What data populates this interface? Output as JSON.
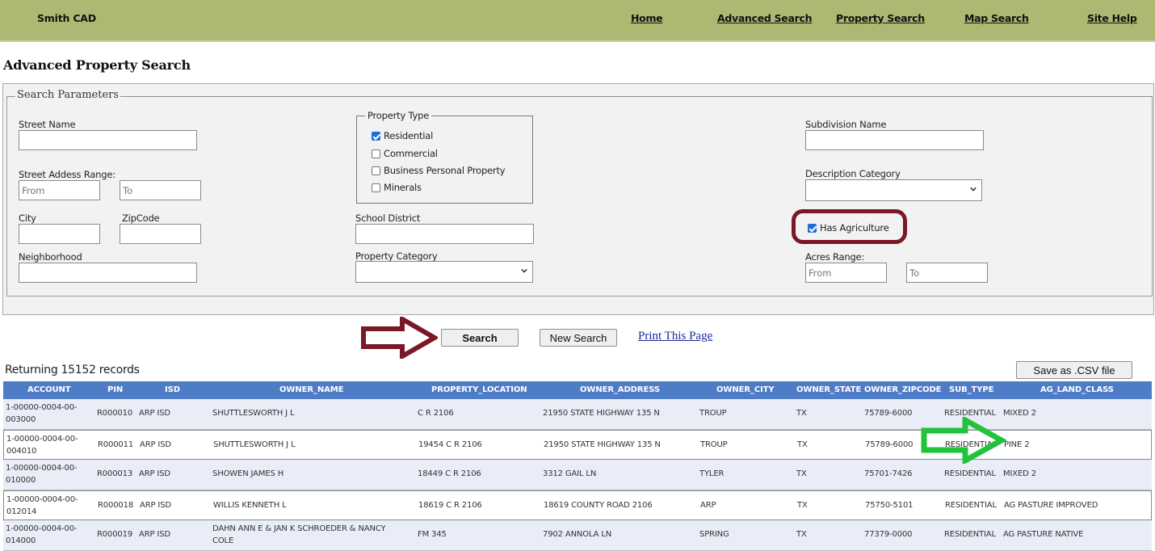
{
  "header": {
    "brand": "Smith CAD",
    "nav": [
      "Home",
      "Advanced Search",
      "Property Search",
      "Map Search",
      "Site Help"
    ],
    "bar_color": "#aeb872"
  },
  "page_title": "Advanced Property Search",
  "search": {
    "legend": "Search Parameters",
    "street_name": {
      "label": "Street Name",
      "value": ""
    },
    "street_address_range": {
      "label": "Street Addess Range:",
      "from_placeholder": "From",
      "to_placeholder": "To"
    },
    "city": {
      "label": "City",
      "value": ""
    },
    "zipcode": {
      "label": "ZipCode",
      "value": ""
    },
    "neighborhood": {
      "label": "Neighborhood",
      "value": ""
    },
    "property_type": {
      "legend": "Property Type",
      "options": [
        {
          "label": "Residential",
          "checked": true
        },
        {
          "label": "Commercial",
          "checked": false
        },
        {
          "label": "Business Personal Property",
          "checked": false
        },
        {
          "label": "Minerals",
          "checked": false
        }
      ]
    },
    "school_district": {
      "label": "School District",
      "value": ""
    },
    "property_category": {
      "label": "Property Category",
      "selected": ""
    },
    "subdivision_name": {
      "label": "Subdivision Name",
      "value": ""
    },
    "description_category": {
      "label": "Description Category",
      "selected": ""
    },
    "has_agriculture": {
      "label": "Has Agriculture",
      "checked": true
    },
    "acres_range": {
      "label": "Acres Range:",
      "from_placeholder": "From",
      "to_placeholder": "To"
    }
  },
  "actions": {
    "search": "Search",
    "new_search": "New Search",
    "print": "Print This Page",
    "save_csv": "Save as .CSV file"
  },
  "annotations": {
    "highlight_color": "#7a1826",
    "arrow_search_color": "#7a1826",
    "arrow_result_color": "#22c33c"
  },
  "results": {
    "summary": "Returning 15152 records",
    "columns": [
      "ACCOUNT",
      "PIN",
      "ISD",
      "OWNER_NAME",
      "PROPERTY_LOCATION",
      "OWNER_ADDRESS",
      "OWNER_CITY",
      "OWNER_STATE",
      "OWNER_ZIPCODE",
      "SUB_TYPE",
      "AG_LAND_CLASS"
    ],
    "rows": [
      {
        "account": "1-00000-0004-00-003000",
        "pin": "R000010",
        "isd": "ARP ISD",
        "owner_name": "SHUTTLESWORTH J L",
        "property_location": "C R 2106",
        "owner_address": "21950 STATE HIGHWAY 135 N",
        "owner_city": "TROUP",
        "owner_state": "TX",
        "owner_zipcode": "75789-6000",
        "sub_type": "RESIDENTIAL",
        "ag_land_class": "MIXED 2"
      },
      {
        "account": "1-00000-0004-00-004010",
        "pin": "R000011",
        "isd": "ARP ISD",
        "owner_name": "SHUTTLESWORTH J L",
        "property_location": "19454 C R 2106",
        "owner_address": "21950 STATE HIGHWAY 135 N",
        "owner_city": "TROUP",
        "owner_state": "TX",
        "owner_zipcode": "75789-6000",
        "sub_type": "RESIDENTIAL",
        "ag_land_class": "PINE 2"
      },
      {
        "account": "1-00000-0004-00-010000",
        "pin": "R000013",
        "isd": "ARP ISD",
        "owner_name": "SHOWEN JAMES H",
        "property_location": "18449 C R 2106",
        "owner_address": "3312 GAIL LN",
        "owner_city": "TYLER",
        "owner_state": "TX",
        "owner_zipcode": "75701-7426",
        "sub_type": "RESIDENTIAL",
        "ag_land_class": "MIXED 2"
      },
      {
        "account": "1-00000-0004-00-012014",
        "pin": "R000018",
        "isd": "ARP ISD",
        "owner_name": "WILLIS KENNETH L",
        "property_location": "18619 C R 2106",
        "owner_address": "18619 COUNTY ROAD 2106",
        "owner_city": "ARP",
        "owner_state": "TX",
        "owner_zipcode": "75750-5101",
        "sub_type": "RESIDENTIAL",
        "ag_land_class": "AG PASTURE IMPROVED"
      },
      {
        "account": "1-00000-0004-00-014000",
        "pin": "R000019",
        "isd": "ARP ISD",
        "owner_name": "DAHN ANN E & JAN K SCHROEDER & NANCY COLE",
        "property_location": "FM 345",
        "owner_address": "7902 ANNOLA LN",
        "owner_city": "SPRING",
        "owner_state": "TX",
        "owner_zipcode": "77379-0000",
        "sub_type": "RESIDENTIAL",
        "ag_land_class": "AG PASTURE NATIVE"
      }
    ]
  }
}
